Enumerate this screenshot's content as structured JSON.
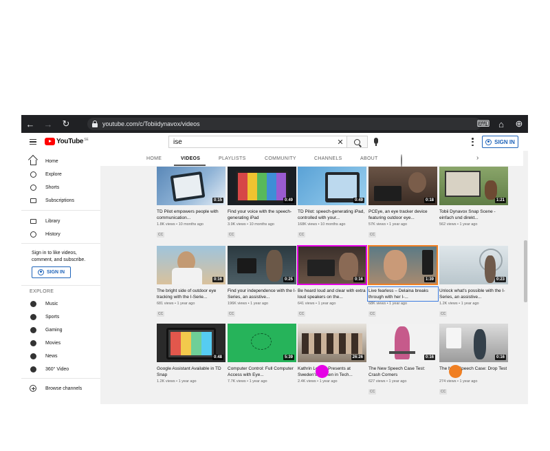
{
  "browser": {
    "url": "youtube.com/c/Tobiidynavox/videos"
  },
  "header": {
    "logo_text": "YouTube",
    "logo_sup": "SE",
    "search_value": "ise",
    "signin_label": "SIGN IN"
  },
  "sidebar": {
    "items": [
      {
        "label": "Home",
        "icon": "home-icon"
      },
      {
        "label": "Explore",
        "icon": "compass-icon"
      },
      {
        "label": "Shorts",
        "icon": "shorts-icon"
      },
      {
        "label": "Subscriptions",
        "icon": "subscriptions-icon"
      }
    ],
    "items2": [
      {
        "label": "Library",
        "icon": "library-icon"
      },
      {
        "label": "History",
        "icon": "history-icon"
      }
    ],
    "signin_msg": "Sign in to like videos, comment, and subscribe.",
    "signin_label": "SIGN IN",
    "explore_heading": "EXPLORE",
    "explore": [
      {
        "label": "Music",
        "icon": "music-icon"
      },
      {
        "label": "Sports",
        "icon": "sports-icon"
      },
      {
        "label": "Gaming",
        "icon": "gaming-icon"
      },
      {
        "label": "Movies",
        "icon": "movies-icon"
      },
      {
        "label": "News",
        "icon": "news-icon"
      },
      {
        "label": "360° Video",
        "icon": "360-video-icon"
      }
    ],
    "browse_label": "Browse channels"
  },
  "tabs": [
    "HOME",
    "VIDEOS",
    "PLAYLISTS",
    "COMMUNITY",
    "CHANNELS",
    "ABOUT"
  ],
  "videos": [
    {
      "title": "TD Pilot empowers people with communication...",
      "meta": "1.8K views • 10 months ago",
      "dur": "0:15",
      "cc": "CC"
    },
    {
      "title": "Find your voice with the speech-generating iPad",
      "meta": "3.9K views • 10 months ago",
      "dur": "0:49",
      "cc": "CC"
    },
    {
      "title": "TD Pilot: speech-generating iPad, controlled with your...",
      "meta": "168K views • 10 months ago",
      "dur": "0:49",
      "cc": "CC"
    },
    {
      "title": "PCEye, an eye tracker device featuring outdoor eye...",
      "meta": "57K views • 1 year ago",
      "dur": "0:18",
      "cc": "CC"
    },
    {
      "title": "Tobii Dynavox Snap Scene - einfach und direkt...",
      "meta": "562 views • 1 year ago",
      "dur": "1:21",
      "cc": ""
    },
    {
      "title": "The bright side of outdoor eye tracking with the I-Serie...",
      "meta": "681 views • 1 year ago",
      "dur": "0:16",
      "cc": "CC"
    },
    {
      "title": "Find your independence with the I-Series, an assistive...",
      "meta": "196K views • 1 year ago",
      "dur": "0:25",
      "cc": "CC"
    },
    {
      "title": "Be heard loud and clear with extra loud speakers on the...",
      "meta": "641 views • 1 year ago",
      "dur": "0:16",
      "cc": "CC"
    },
    {
      "title": "Live fearless – Delaina breaks through with her I-...",
      "meta": "68K views • 1 year ago",
      "dur": "1:39",
      "cc": "CC"
    },
    {
      "title": "Unlock what's possible with the I-Series, an assistive...",
      "meta": "1.2K views • 1 year ago",
      "dur": "0:23",
      "cc": "CC"
    },
    {
      "title": "Google Assistant Available in TD Snap",
      "meta": "1.2K views • 1 year ago",
      "dur": "0:48",
      "cc": ""
    },
    {
      "title": "Computer Control: Full Computer Access with Eye...",
      "meta": "7.7K views • 1 year ago",
      "dur": "5:39",
      "cc": ""
    },
    {
      "title": "Kathrin Lemler Presents at Sweden's Women in Tech...",
      "meta": "2.4K views • 1 year ago",
      "dur": "26:26",
      "cc": ""
    },
    {
      "title": "The New Speech Case Test: Crash Corners",
      "meta": "627 views • 1 year ago",
      "dur": "0:16",
      "cc": "CC"
    },
    {
      "title": "The New Speech Case: Drop Test",
      "meta": "274 views • 1 year ago",
      "dur": "0:16",
      "cc": "CC"
    }
  ],
  "colors": {
    "magenta": "#e600e6",
    "orange": "#f07f22",
    "blue": "#2563eb",
    "accent": "#1c62b9"
  }
}
